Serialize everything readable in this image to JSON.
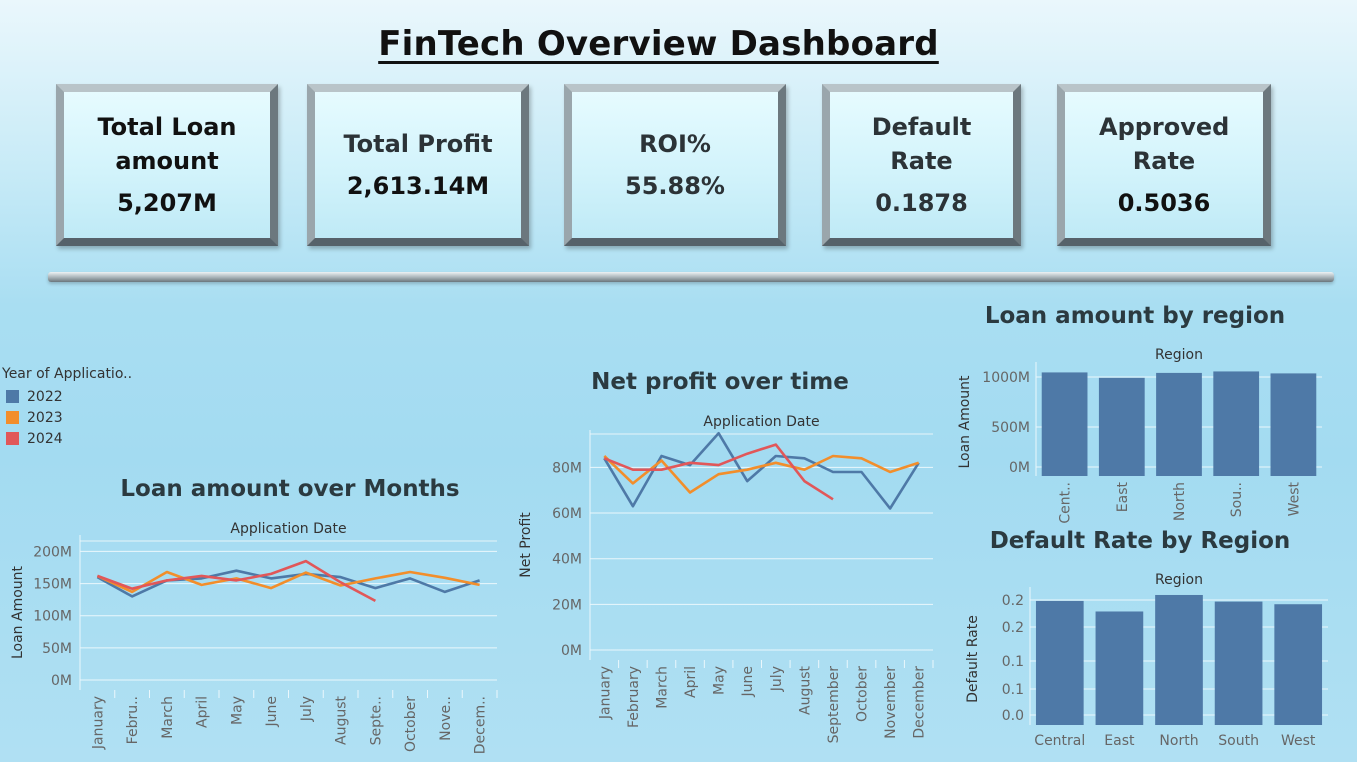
{
  "dashboard": {
    "title": "FinTech Overview Dashboard"
  },
  "kpis": [
    {
      "label": "Total Loan amount",
      "value": "5,207M"
    },
    {
      "label": "Total Profit",
      "value": "2,613.14M"
    },
    {
      "label": "ROI%",
      "value": "55.88%"
    },
    {
      "label": "Default Rate",
      "value": "0.1878"
    },
    {
      "label": "Approved Rate",
      "value": "0.5036"
    }
  ],
  "legend": {
    "title": "Year of Applicatio..",
    "items": [
      {
        "label": "2022",
        "color": "#4e79a7"
      },
      {
        "label": "2023",
        "color": "#f28e2b"
      },
      {
        "label": "2024",
        "color": "#e15759"
      }
    ]
  },
  "chart_data": [
    {
      "id": "loan_over_months",
      "type": "line",
      "title": "Loan amount over Months",
      "xlabel": "Application Date",
      "ylabel": "Loan Amount",
      "categories": [
        "January",
        "Febru..",
        "March",
        "April",
        "May",
        "June",
        "July",
        "August",
        "Septe..",
        "October",
        "Nove..",
        "Decem.."
      ],
      "yticks": [
        "0M",
        "50M",
        "100M",
        "150M",
        "200M"
      ],
      "ylim": [
        0,
        210
      ],
      "grid": true,
      "series": [
        {
          "name": "2022",
          "values": [
            160,
            130,
            155,
            158,
            170,
            158,
            165,
            160,
            143,
            158,
            137,
            155
          ]
        },
        {
          "name": "2023",
          "values": [
            162,
            137,
            168,
            148,
            158,
            143,
            167,
            147,
            158,
            168,
            159,
            148
          ]
        },
        {
          "name": "2024",
          "values": [
            162,
            142,
            155,
            162,
            155,
            165,
            185,
            152,
            123,
            null,
            null,
            null
          ]
        }
      ]
    },
    {
      "id": "net_profit_over_time",
      "type": "line",
      "title": "Net profit over time",
      "xlabel": "Application Date",
      "ylabel": "Net Profit",
      "categories": [
        "January",
        "February",
        "March",
        "April",
        "May",
        "June",
        "July",
        "August",
        "September",
        "October",
        "November",
        "December"
      ],
      "yticks": [
        "0M",
        "20M",
        "40M",
        "60M",
        "80M"
      ],
      "ylim": [
        0,
        92
      ],
      "grid": true,
      "series": [
        {
          "name": "2022",
          "values": [
            84,
            63,
            85,
            81,
            95,
            74,
            85,
            84,
            78,
            78,
            62,
            82
          ]
        },
        {
          "name": "2023",
          "values": [
            85,
            73,
            83,
            69,
            77,
            79,
            82,
            79,
            85,
            84,
            78,
            82
          ]
        },
        {
          "name": "2024",
          "values": [
            84,
            79,
            79,
            82,
            81,
            86,
            90,
            74,
            66,
            null,
            null,
            null
          ]
        }
      ]
    },
    {
      "id": "loan_by_region",
      "type": "bar",
      "title": "Loan amount by region",
      "xlabel": "Region",
      "ylabel": "Loan Amount",
      "categories": [
        "Cent..",
        "East",
        "North",
        "Sou..",
        "West"
      ],
      "values": [
        1055,
        1000,
        1050,
        1065,
        1045
      ],
      "yticks": [
        "0M",
        "500M",
        "1000M"
      ],
      "ylim": [
        0,
        1100
      ],
      "color": "#4e79a7"
    },
    {
      "id": "default_by_region",
      "type": "bar",
      "title": "Default Rate by Region",
      "xlabel": "Region",
      "ylabel": "Default Rate",
      "categories": [
        "Central",
        "East",
        "North",
        "South",
        "West"
      ],
      "values": [
        0.188,
        0.172,
        0.197,
        0.187,
        0.183
      ],
      "yticks": [
        "0.0",
        "0.1",
        "0.1",
        "0.2",
        "0.2"
      ],
      "ylim": [
        0,
        0.2
      ],
      "color": "#4e79a7"
    }
  ],
  "colors": {
    "2022": "#4e79a7",
    "2023": "#f28e2b",
    "2024": "#e15759",
    "bar": "#4e79a7"
  }
}
